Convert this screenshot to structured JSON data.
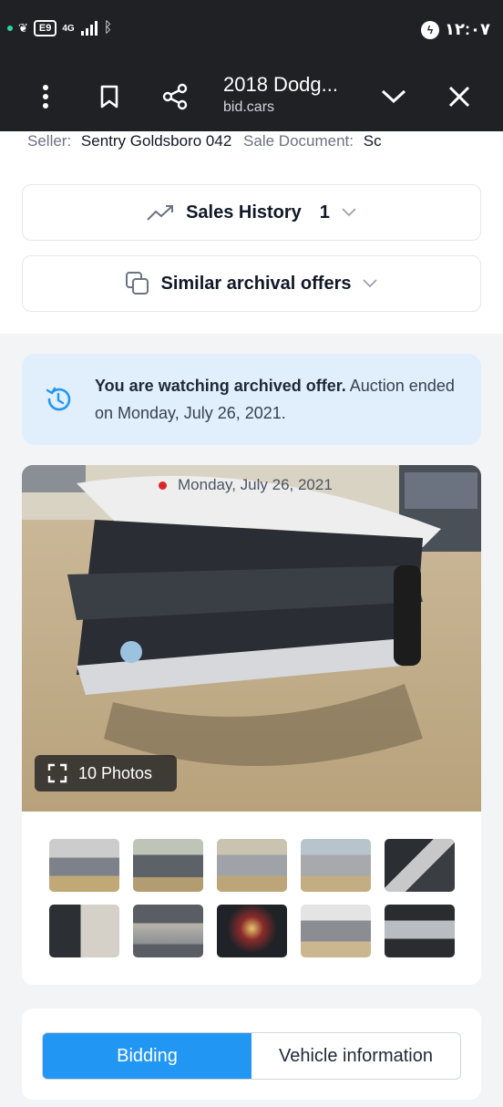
{
  "status_bar": {
    "battery": "E9",
    "network": "4G",
    "time": "۱۲:۰۷"
  },
  "browser": {
    "title": "2018 Dodg...",
    "domain": "bid.cars"
  },
  "seller": {
    "label": "Seller:",
    "value": "Sentry Goldsboro 042",
    "doc_label": "Sale Document:",
    "doc_value": "Sc"
  },
  "sales_history": {
    "label": "Sales History",
    "count": "1"
  },
  "similar": {
    "label": "Similar archival offers"
  },
  "notice": {
    "bold": "You are watching archived offer.",
    "rest": " Auction ended on Monday, July 26, 2021."
  },
  "gallery": {
    "date": "Monday, July 26, 2021",
    "photos_label": "10 Photos",
    "thumbnail_count": 10
  },
  "tabs": [
    {
      "label": "Bidding",
      "active": true
    },
    {
      "label": "Vehicle information",
      "active": false
    }
  ],
  "colors": {
    "accent": "#2196f3",
    "notice_bg": "#e0effb",
    "toolbar_bg": "#202124",
    "live_dot": "#dc2626"
  }
}
